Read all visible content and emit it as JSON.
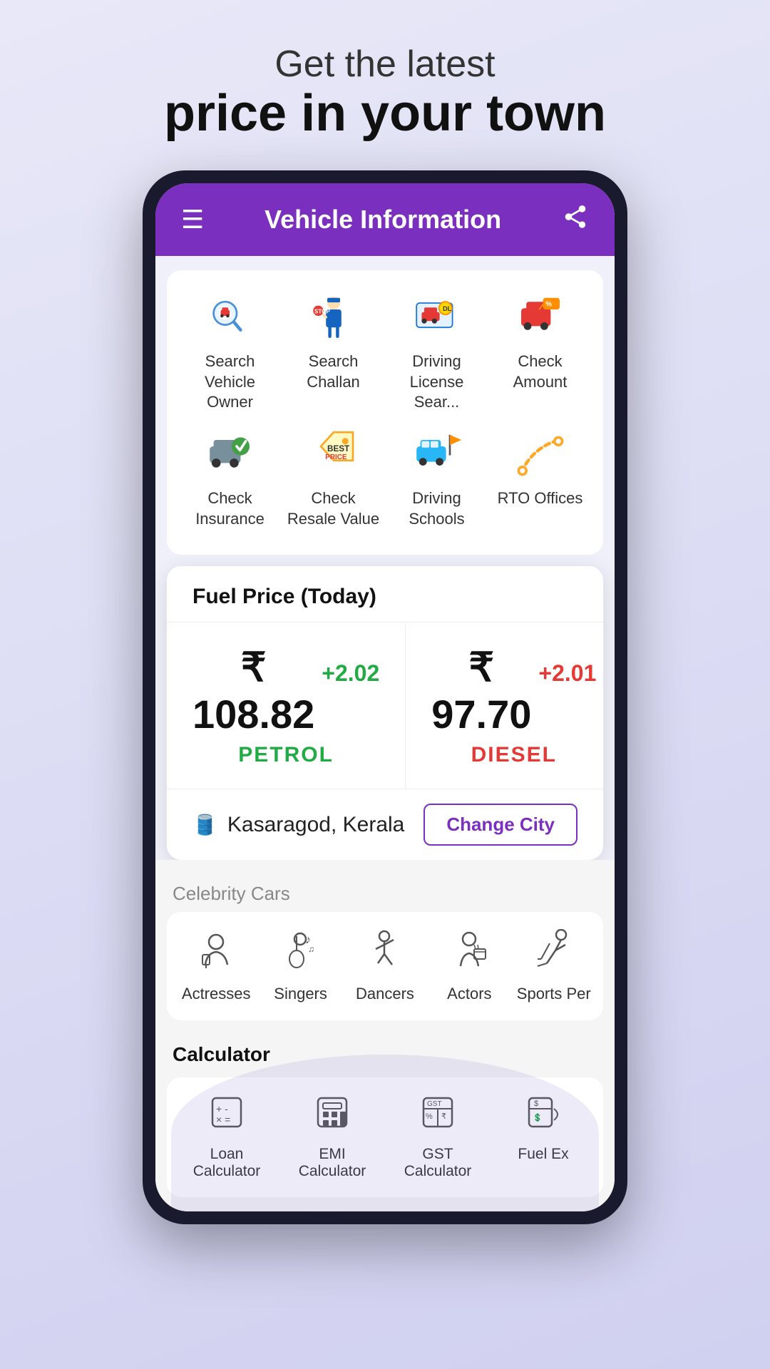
{
  "hero": {
    "subtitle": "Get the latest",
    "title": "price in your town"
  },
  "app": {
    "header_title": "Vehicle Information"
  },
  "grid": {
    "row1": [
      {
        "label": "Search Vehicle Owner",
        "icon": "search_vehicle"
      },
      {
        "label": "Search Challan",
        "icon": "search_challan"
      },
      {
        "label": "Driving License Sear...",
        "icon": "driving_license"
      },
      {
        "label": "Check Amount",
        "icon": "check_amount"
      }
    ],
    "row2": [
      {
        "label": "Check Insurance",
        "icon": "check_insurance"
      },
      {
        "label": "Check Resale Value",
        "icon": "check_resale"
      },
      {
        "label": "Driving Schools",
        "icon": "driving_schools"
      },
      {
        "label": "RTO Offices",
        "icon": "rto_offices"
      }
    ]
  },
  "fuel": {
    "card_title": "Fuel Price (Today)",
    "petrol_amount": "₹ 108.82",
    "petrol_change": "+2.02",
    "petrol_label": "PETROL",
    "diesel_amount": "₹ 97.70",
    "diesel_change": "+2.01",
    "diesel_label": "DIESEL",
    "city": "Kasaragod, Kerala",
    "change_city_btn": "Change City"
  },
  "celebrity": {
    "section_label": "Celebrity Cars",
    "items": [
      {
        "label": "Actresses",
        "icon": "🎭"
      },
      {
        "label": "Singers",
        "icon": "🎸"
      },
      {
        "label": "Dancers",
        "icon": "💃"
      },
      {
        "label": "Actors",
        "icon": "🎬"
      },
      {
        "label": "Sports Per",
        "icon": "⛷️"
      }
    ]
  },
  "calculator": {
    "section_label": "Calculator",
    "items": [
      {
        "label": "Loan Calculator",
        "icon": "🧮"
      },
      {
        "label": "EMI Calculator",
        "icon": "📊"
      },
      {
        "label": "GST Calculator",
        "icon": "🔢"
      },
      {
        "label": "Fuel Ex",
        "icon": "💵"
      }
    ]
  }
}
